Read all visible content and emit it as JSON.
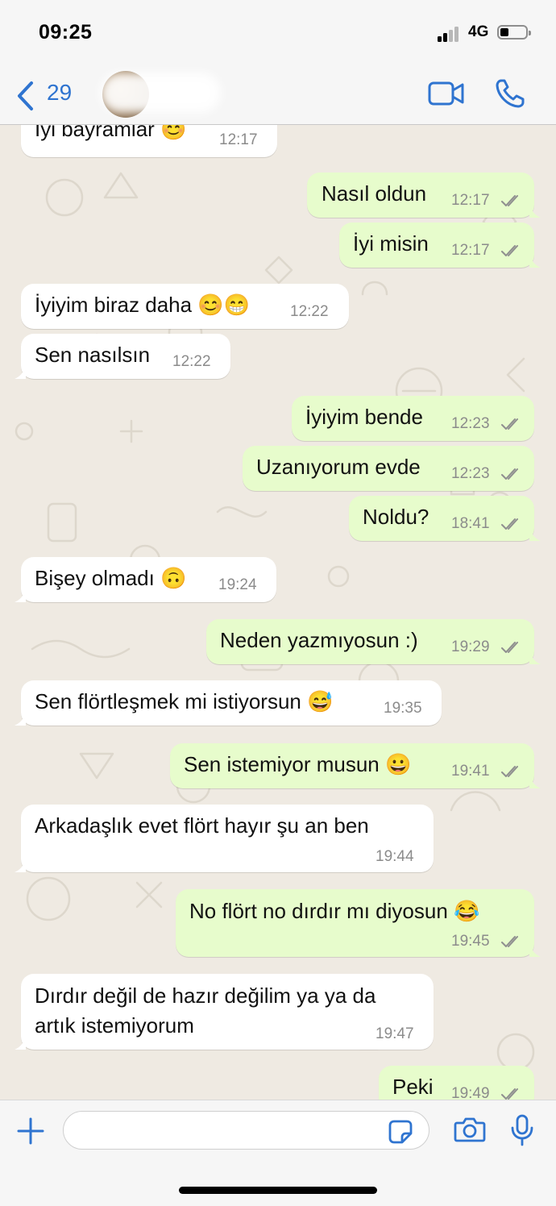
{
  "status_bar": {
    "time": "09:25",
    "network": "4G",
    "signal_icon": "cellular-signal-icon",
    "battery_icon": "battery-icon"
  },
  "header": {
    "back_count": "29",
    "icons": [
      "chevron-left-icon",
      "video-call-icon",
      "phone-call-icon"
    ],
    "accent_color": "#2f74d0"
  },
  "messages": [
    {
      "direction": "in",
      "text": "İyi bayramlar 😊",
      "time": "12:17"
    },
    {
      "direction": "out",
      "text": "Nasıl oldun",
      "time": "12:17"
    },
    {
      "direction": "out",
      "text": "İyi misin",
      "time": "12:17"
    },
    {
      "direction": "in",
      "text": "İyiyim biraz daha 😊😁",
      "time": "12:22"
    },
    {
      "direction": "in",
      "text": "Sen nasılsın",
      "time": "12:22"
    },
    {
      "direction": "out",
      "text": "İyiyim bende",
      "time": "12:23"
    },
    {
      "direction": "out",
      "text": "Uzanıyorum evde",
      "time": "12:23"
    },
    {
      "direction": "out",
      "text": "Noldu?",
      "time": "18:41"
    },
    {
      "direction": "in",
      "text": "Bişey olmadı 🙃",
      "time": "19:24"
    },
    {
      "direction": "out",
      "text": "Neden yazmıyosun :)",
      "time": "19:29"
    },
    {
      "direction": "in",
      "text": "Sen flörtleşmek mi istiyorsun 😅",
      "time": "19:35"
    },
    {
      "direction": "out",
      "text": "Sen istemiyor musun 😀",
      "time": "19:41"
    },
    {
      "direction": "in",
      "text": "Arkadaşlık evet flört hayır şu an ben",
      "time": "19:44"
    },
    {
      "direction": "out",
      "text": "No flört no dırdır mı diyosun 😂",
      "time": "19:45"
    },
    {
      "direction": "in",
      "text": "Dırdır değil de hazır değilim ya ya da artık istemiyorum",
      "time": "19:47"
    },
    {
      "direction": "out",
      "text": "Peki",
      "time": "19:49"
    }
  ],
  "colors": {
    "incoming_bubble": "#ffffff",
    "outgoing_bubble": "#e7fccc",
    "chat_background": "#efeae2",
    "read_ticks": "#8f8f8f"
  },
  "input_bar": {
    "placeholder": "",
    "icons": [
      "plus-icon",
      "sticker-icon",
      "camera-icon",
      "microphone-icon"
    ]
  }
}
